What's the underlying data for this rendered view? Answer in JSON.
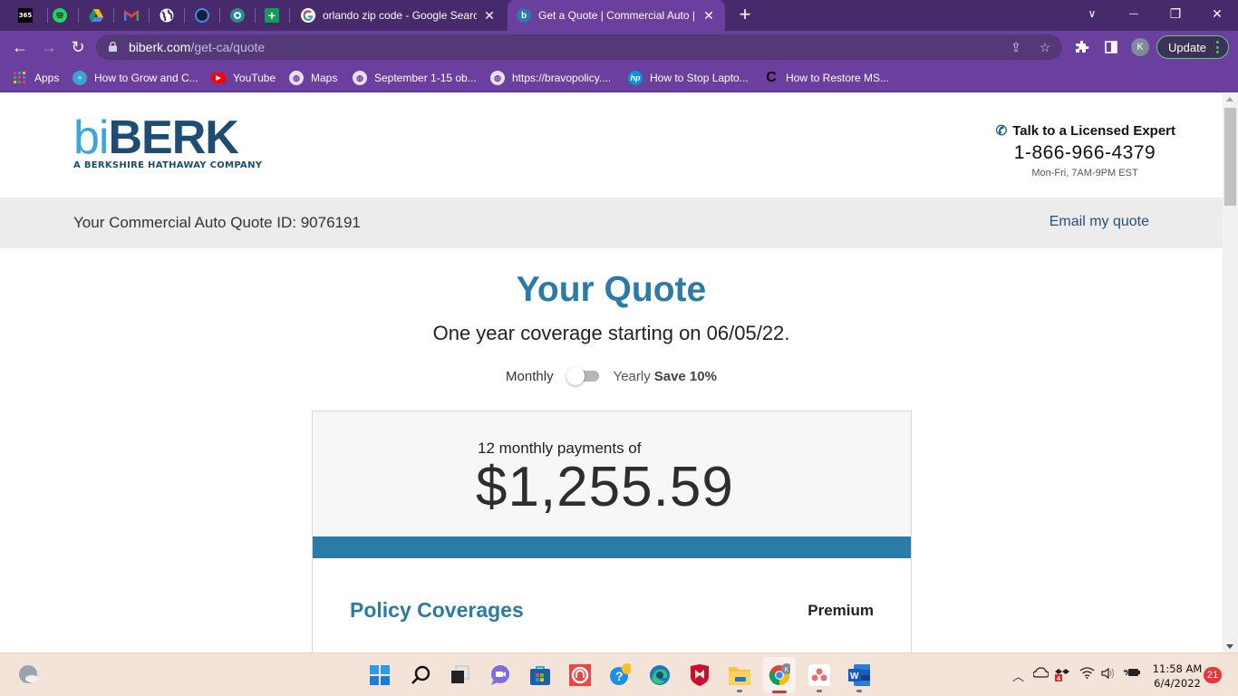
{
  "browser": {
    "pinned_tabs": [
      {
        "name": "microsoft-365",
        "icon": "m365-icon"
      },
      {
        "name": "spotify",
        "icon": "spotify-icon"
      },
      {
        "name": "google-drive",
        "icon": "google-drive-icon"
      },
      {
        "name": "gmail",
        "icon": "gmail-icon"
      },
      {
        "name": "web",
        "icon": "globe-icon"
      },
      {
        "name": "cortana",
        "icon": "cortana-icon"
      },
      {
        "name": "app",
        "icon": "app-icon"
      },
      {
        "name": "google-classroom",
        "icon": "classroom-icon"
      }
    ],
    "tabs": [
      {
        "title": "orlando zip code - Google Search",
        "favicon": "google-icon",
        "active": false
      },
      {
        "title": "Get a Quote | Commercial Auto | biBERK",
        "favicon": "biberk-icon",
        "active": true
      }
    ],
    "new_tab_label": "+",
    "window_controls": {
      "tab_search": "∨",
      "minimize": "—",
      "restore": "❐",
      "close": "✕"
    },
    "address": {
      "domain": "biberk.com",
      "path": "/get-ca/quote"
    },
    "update_label": "Update",
    "profile_initial": "K",
    "bookmarks": [
      {
        "label": "Apps",
        "icon": "apps-grid-icon"
      },
      {
        "label": "How to Grow and C...",
        "icon": "bookmark-fish-icon"
      },
      {
        "label": "YouTube",
        "icon": "youtube-icon"
      },
      {
        "label": "Maps",
        "icon": "globe-icon"
      },
      {
        "label": "September 1-15 ob...",
        "icon": "globe-icon"
      },
      {
        "label": "https://bravopolicy....",
        "icon": "globe-icon"
      },
      {
        "label": "How to Stop Lapto...",
        "icon": "hp-icon"
      },
      {
        "label": "How to Restore MS...",
        "icon": "c-icon"
      }
    ]
  },
  "page": {
    "logo": {
      "bi": "bi",
      "berk": "BERK",
      "tagline": "A BERKSHIRE HATHAWAY COMPANY"
    },
    "contact": {
      "talk_label": "Talk to a Licensed Expert",
      "phone": "1-866-966-4379",
      "hours": "Mon-Fri, 7AM-9PM EST"
    },
    "quote_bar": {
      "quote_id_text": "Your Commercial Auto Quote ID: 9076191",
      "email_link": "Email my quote"
    },
    "title": "Your Quote",
    "subtitle": "One year coverage starting on 06/05/22.",
    "billing_toggle": {
      "monthly_label": "Monthly",
      "yearly_label": "Yearly",
      "save_label": "Save 10%",
      "selected": "Monthly"
    },
    "quote_card": {
      "payments_label": "12 monthly payments of",
      "amount": "$1,255.59",
      "coverages_title": "Policy Coverages",
      "premium_label": "Premium"
    },
    "colors": {
      "brand_blue": "#2b7ba8",
      "brand_navy": "#1d4d74",
      "brand_light": "#3aa6dc"
    }
  },
  "taskbar": {
    "apps": [
      {
        "name": "start",
        "icon": "windows-start-icon"
      },
      {
        "name": "search",
        "icon": "search-icon"
      },
      {
        "name": "task-view",
        "icon": "task-view-icon"
      },
      {
        "name": "teams-chat",
        "icon": "chat-icon"
      },
      {
        "name": "microsoft-store",
        "icon": "store-icon"
      },
      {
        "name": "app-red",
        "icon": "red-app-icon"
      },
      {
        "name": "get-help",
        "icon": "help-icon"
      },
      {
        "name": "edge",
        "icon": "edge-icon"
      },
      {
        "name": "mcafee",
        "icon": "mcafee-icon"
      },
      {
        "name": "file-explorer",
        "icon": "folder-icon"
      },
      {
        "name": "chrome",
        "icon": "chrome-icon"
      },
      {
        "name": "asana",
        "icon": "asana-icon"
      },
      {
        "name": "word",
        "icon": "word-icon"
      }
    ],
    "tray": {
      "time": "11:58 AM",
      "date": "6/4/2022",
      "notification_count": "21",
      "dropbox_badge": "4"
    }
  }
}
